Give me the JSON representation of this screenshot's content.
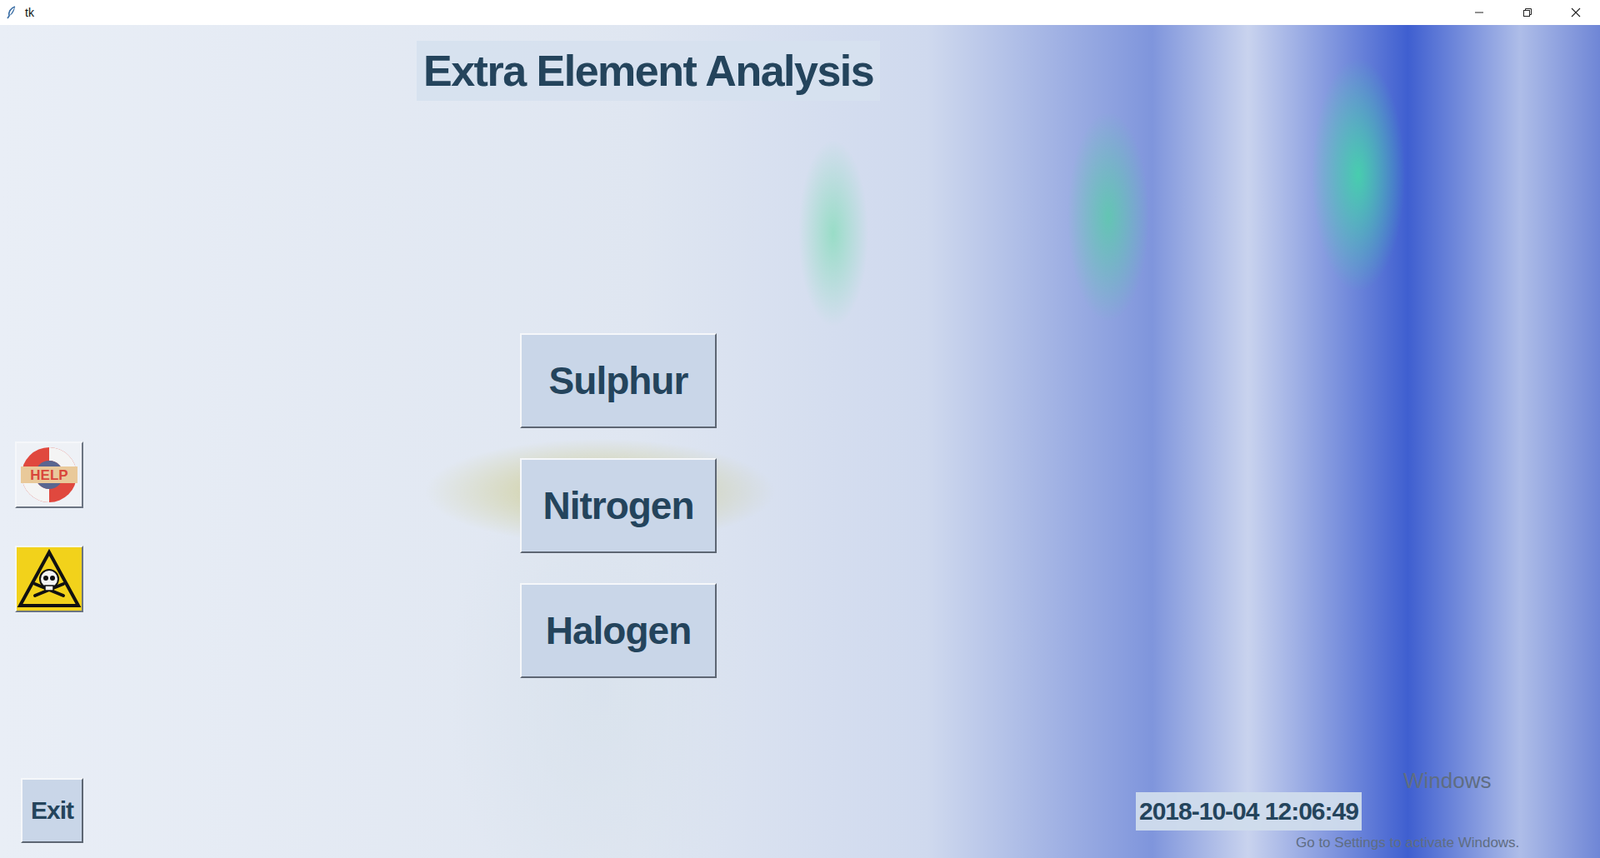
{
  "window": {
    "title": "tk"
  },
  "heading": "Extra Element Analysis",
  "elements": [
    {
      "label": "Sulphur"
    },
    {
      "label": "Nitrogen"
    },
    {
      "label": "Halogen"
    }
  ],
  "help_button": {
    "label": "HELP"
  },
  "exit_button": {
    "label": "Exit"
  },
  "clock": "2018-10-04 12:06:49",
  "watermark": [
    "Windows",
    "Go to Settings to activate Windows."
  ]
}
